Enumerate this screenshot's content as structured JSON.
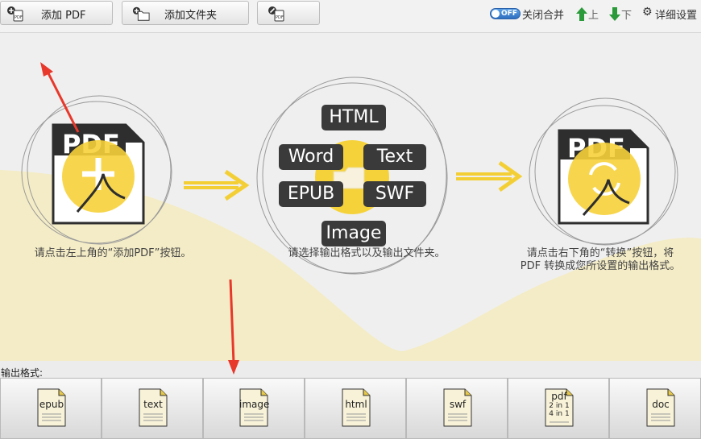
{
  "toolbar": {
    "add_pdf_label": "添加 PDF",
    "add_folder_label": "添加文件夹",
    "merge_label": "关闭合并",
    "toggle_text": "OFF",
    "up_label": "上",
    "down_label": "下",
    "settings_label": "详细设置"
  },
  "steps": {
    "step1_text": "请点击左上角的“添加PDF”按钮。",
    "step2_text": "请选择输出格式以及输出文件夹。",
    "step3_line1": "请点击右下角的“转换”按钮，将",
    "step3_line2": "PDF 转换成您所设置的输出格式。"
  },
  "illustration": {
    "pdf_text_left": "PDF",
    "pdf_text_right": "PDF",
    "formats": [
      "HTML",
      "Word",
      "Text",
      "EPUB",
      "SWF",
      "Image"
    ]
  },
  "output": {
    "label": "输出格式:",
    "formats": [
      "epub",
      "text",
      "image",
      "html",
      "swf",
      "pdf",
      "doc"
    ],
    "pdf_sub1": "2 in 1",
    "pdf_sub2": "4 in 1"
  },
  "colors": {
    "accent_yellow": "#f6d23a",
    "arrow_red": "#e8382b",
    "toggle_blue": "#3a7fd0",
    "dark": "#2e2e2e"
  }
}
